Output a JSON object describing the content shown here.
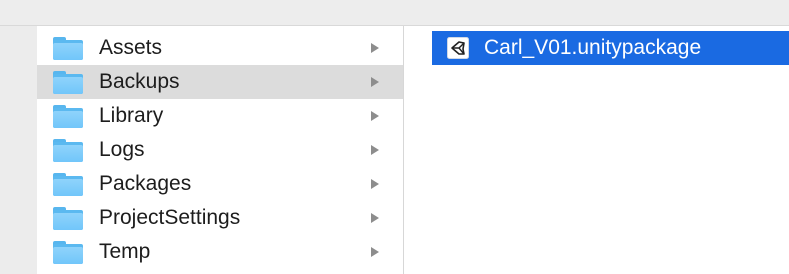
{
  "colors": {
    "selection_blue": "#1a6ae2",
    "selection_gray": "#dcdcdc",
    "folder_blue": "#71c6fa"
  },
  "folders": [
    {
      "label": "Assets",
      "icon": "folder-icon",
      "has_children": true,
      "selected": false
    },
    {
      "label": "Backups",
      "icon": "folder-icon",
      "has_children": true,
      "selected": true
    },
    {
      "label": "Library",
      "icon": "folder-icon",
      "has_children": true,
      "selected": false
    },
    {
      "label": "Logs",
      "icon": "folder-icon",
      "has_children": true,
      "selected": false
    },
    {
      "label": "Packages",
      "icon": "folder-icon",
      "has_children": true,
      "selected": false
    },
    {
      "label": "ProjectSettings",
      "icon": "folder-icon",
      "has_children": true,
      "selected": false
    },
    {
      "label": "Temp",
      "icon": "folder-icon",
      "has_children": true,
      "selected": false
    }
  ],
  "files": [
    {
      "label": "Carl_V01.unitypackage",
      "icon": "unity-package-icon",
      "selected": true
    }
  ]
}
